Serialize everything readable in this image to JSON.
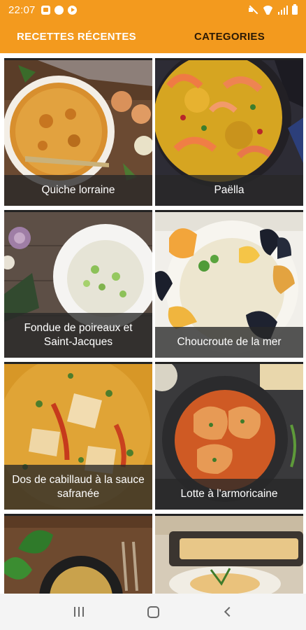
{
  "status_bar": {
    "time": "22:07",
    "left_icons": [
      "mail-icon",
      "cloud-icon",
      "play-icon"
    ],
    "right_icons": [
      "mute-icon",
      "wifi-icon",
      "signal-icon",
      "battery-icon"
    ]
  },
  "tabs": [
    {
      "label": "RECETTES RÉCENTES",
      "active": true
    },
    {
      "label": "CATEGORIES",
      "active": false
    }
  ],
  "recipes": [
    {
      "title": "Quiche lorraine"
    },
    {
      "title": "Paëlla"
    },
    {
      "title": "Fondue de poireaux et Saint-Jacques"
    },
    {
      "title": "Choucroute de la mer"
    },
    {
      "title": "Dos de cabillaud à la sauce safranée"
    },
    {
      "title": "Lotte à l'armoricaine"
    },
    {
      "title": ""
    },
    {
      "title": ""
    }
  ],
  "nav_bar": {
    "buttons": [
      "recents-icon",
      "home-icon",
      "back-icon"
    ]
  },
  "colors": {
    "accent": "#f39a1e",
    "caption_bg": "#2a2a2a",
    "inactive_tab_text": "#2c1a05"
  }
}
